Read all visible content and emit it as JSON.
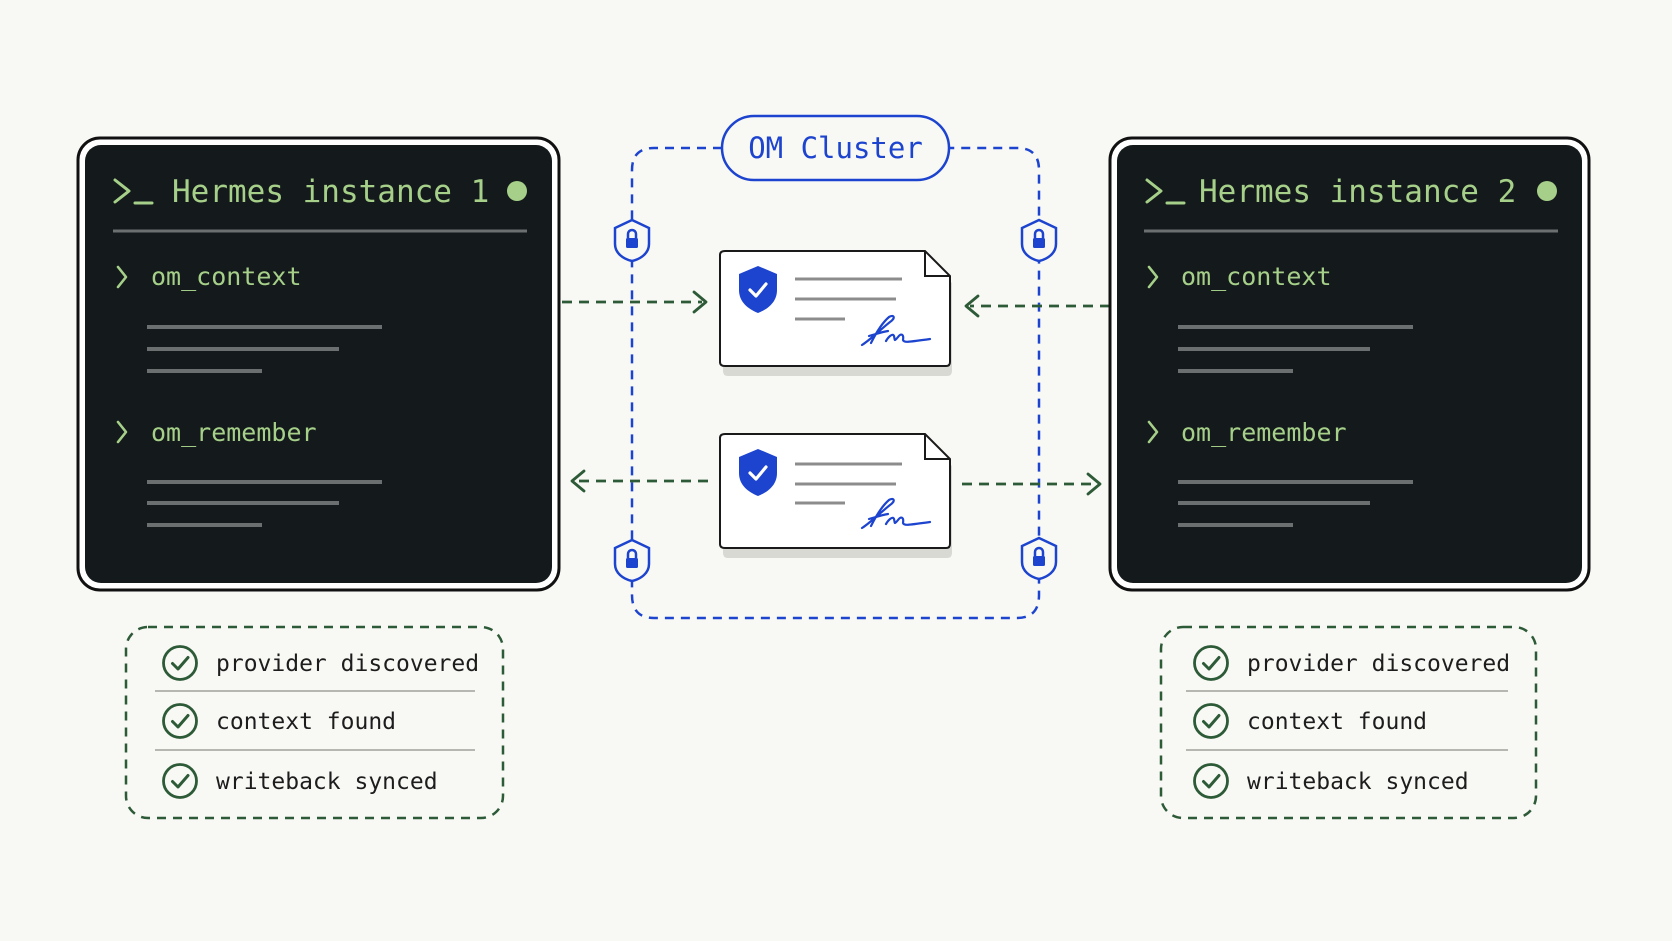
{
  "cluster": {
    "label": "OM Cluster"
  },
  "instances": [
    {
      "title": "Hermes instance 1",
      "prompt_glyph": ">_",
      "status": "online",
      "items": [
        {
          "label": "om_context"
        },
        {
          "label": "om_remember"
        }
      ],
      "checks": [
        "provider discovered",
        "context found",
        "writeback synced"
      ]
    },
    {
      "title": "Hermes instance 2",
      "prompt_glyph": ">_",
      "status": "online",
      "items": [
        {
          "label": "om_context"
        },
        {
          "label": "om_remember"
        }
      ],
      "checks": [
        "provider discovered",
        "context found",
        "writeback synced"
      ]
    }
  ],
  "documents": [
    {
      "icon": "shield-check-icon",
      "signature": "signature-icon"
    },
    {
      "icon": "shield-check-icon",
      "signature": "signature-icon"
    }
  ],
  "colors": {
    "background": "#f8f8f4",
    "terminal_bg": "#141a1b",
    "terminal_text": "#a6d089",
    "cluster_blue": "#1d44cf",
    "check_green": "#2d5a37",
    "arrow_green": "#2d5a37"
  }
}
